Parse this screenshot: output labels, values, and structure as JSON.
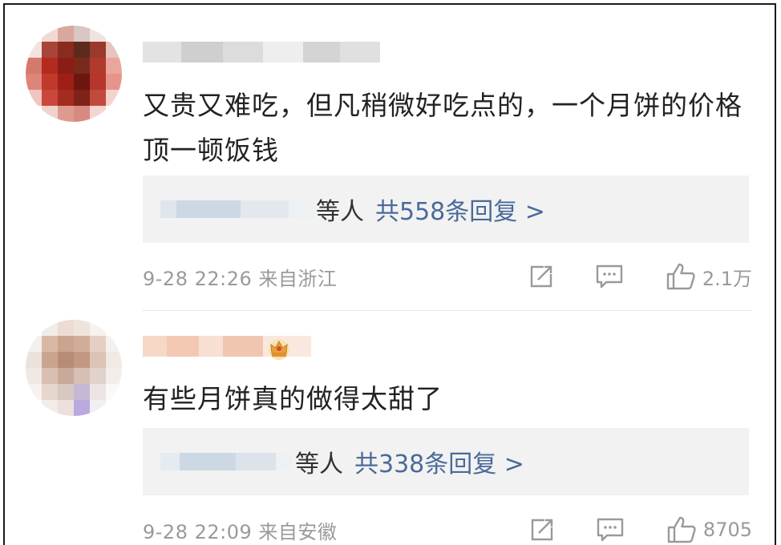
{
  "comments": [
    {
      "text": "又贵又难吃，但凡稍微好吃点的，一个月饼的价格顶一顿饭钱",
      "reply_suffix": "等人",
      "reply_link": "共558条回复 >",
      "timestamp": "9-28 22:26 来自浙江",
      "likes": "2.1万",
      "has_crown_badge": false
    },
    {
      "text": "有些月饼真的做得太甜了",
      "reply_suffix": "等人",
      "reply_link": "共338条回复 >",
      "timestamp": "9-28 22:09 来自安徽",
      "likes": "8705",
      "has_crown_badge": true
    }
  ],
  "icons": {
    "share": "share-icon",
    "comment": "comment-icon",
    "like": "thumbs-up-icon",
    "badge": "crown-icon"
  },
  "colors": {
    "reply_link": "#4a6a99",
    "meta_text": "#9a9a9a",
    "reply_background": "#f2f2f2"
  }
}
